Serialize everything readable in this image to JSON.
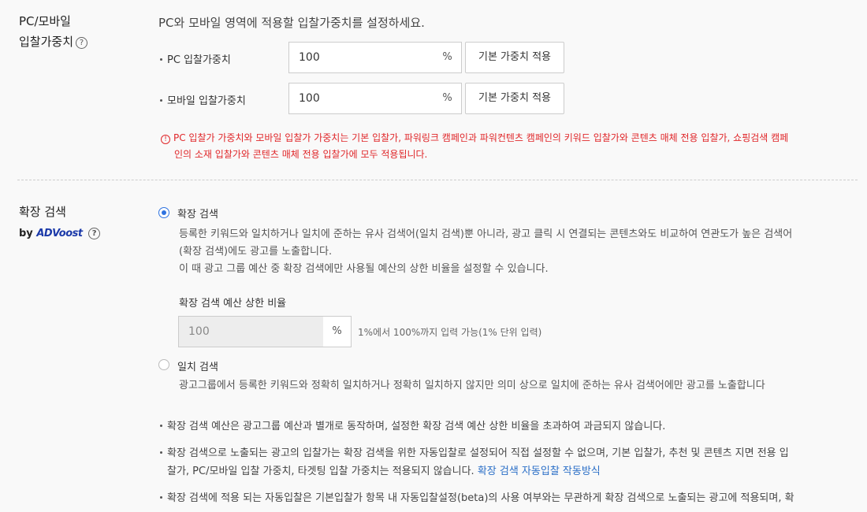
{
  "pc_mobile": {
    "title_line1": "PC/모바일",
    "title_line2": "입찰가중치",
    "description": "PC와 모바일 영역에 적용할 입찰가중치를 설정하세요.",
    "pc_label": "PC 입찰가중치",
    "pc_value": "100",
    "mobile_label": "모바일 입찰가중치",
    "mobile_value": "100",
    "unit": "%",
    "apply_default_label": "기본 가중치 적용",
    "warning_line1": "PC 입찰가 가중치와 모바일 입찰가 가중치는 기본 입찰가, 파워링크 캠페인과 파워컨텐츠 캠페인의 키워드 입찰가와 콘텐츠 매체 전용 입찰가, 쇼핑검색 캠페",
    "warning_line2": "인의 소재 입찰가와 콘텐츠 매체 전용 입찰가에 모두 적용됩니다."
  },
  "expand": {
    "title": "확장 검색",
    "by": "by",
    "logo_ad": "AD",
    "logo_boost": "Voost",
    "option_on_label": "확장 검색",
    "option_on_desc1": "등록한 키워드와 일치하거나 일치에 준하는 유사 검색어(일치 검색)뿐 아니라, 광고 클릭 시 연결되는 콘텐츠와도 비교하여 연관도가 높은 검색어",
    "option_on_desc2": "(확장 검색)에도 광고를 노출합니다.",
    "option_on_desc3": "이 때 광고 그룹 예산 중 확장 검색에만 사용될 예산의 상한 비율을 설정할 수 있습니다.",
    "budget_label": "확장 검색 예산 상한 비율",
    "budget_value": "100",
    "budget_unit": "%",
    "budget_hint": "1%에서 100%까지 입력 가능(1% 단위 입력)",
    "option_off_label": "일치 검색",
    "option_off_desc": "광고그룹에서 등록한 키워드와 정확히 일치하거나 정확히 일치하지 않지만 의미 상으로 일치에 준하는 유사 검색어에만 광고를 노출합니다",
    "note1": "확장 검색 예산은 광고그룹 예산과 별개로 동작하며, 설정한 확장 검색 예산 상한 비율을 초과하여 과금되지 않습니다.",
    "note2_line1": "확장 검색으로 노출되는 광고의 입찰가는 확장 검색을 위한 자동입찰로 설정되어 직접 설정할 수 없으며, 기본 입찰가, 추천 및 콘텐츠 지면 전용 입",
    "note2_line2": "찰가, PC/모바일 입찰 가중치, 타겟팅 입찰 가중치는 적용되지 않습니다.",
    "note2_link": "확장 검색 자동입찰 작동방식",
    "note3": "확장 검색에 적용 되는 자동입찰은 기본입찰가 항목 내 자동입찰설정(beta)의 사용 여부와는 무관하게 확장 검색으로 노출되는 광고에 적용되며, 확"
  },
  "colors": {
    "accent": "#2f73e0",
    "warning": "#e0272a",
    "link": "#2b6fc7",
    "logo": "#1c3aa9"
  }
}
